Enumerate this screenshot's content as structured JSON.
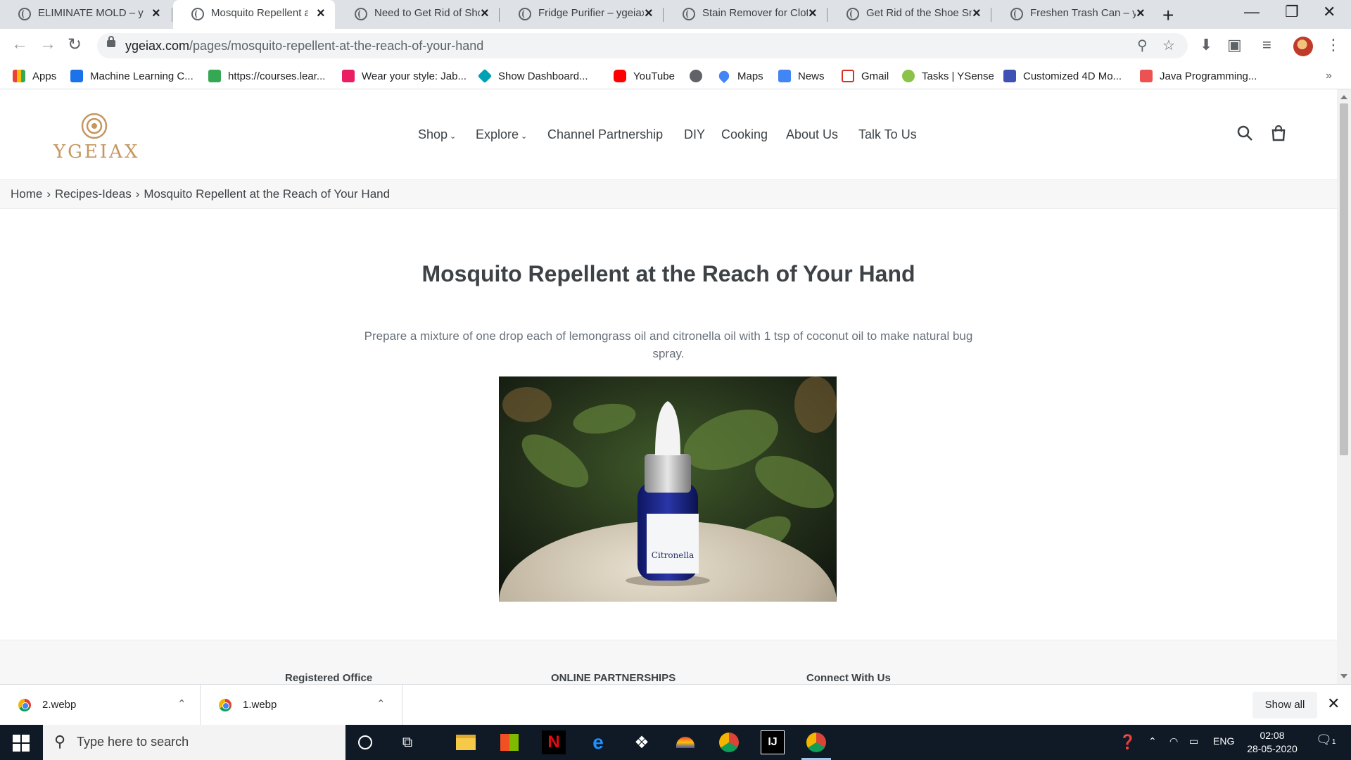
{
  "browser": {
    "tabs": [
      {
        "title": "ELIMINATE MOLD – yg",
        "active": false
      },
      {
        "title": "Mosquito Repellent at t",
        "active": true
      },
      {
        "title": "Need to Get Rid of Sho",
        "active": false
      },
      {
        "title": "Fridge Purifier – ygeiax",
        "active": false
      },
      {
        "title": "Stain Remover for Clot",
        "active": false
      },
      {
        "title": "Get Rid of the Shoe Sm",
        "active": false
      },
      {
        "title": "Freshen Trash Can – yg",
        "active": false
      }
    ],
    "url_host": "ygeiax.com",
    "url_path": "/pages/mosquito-repellent-at-the-reach-of-your-hand",
    "bookmarks": [
      {
        "label": "Apps",
        "icon": "apps-grid-icon",
        "color": "#ea4335"
      },
      {
        "label": "Machine Learning C...",
        "icon": "ml-course-icon",
        "color": "#1a73e8"
      },
      {
        "label": "https://courses.lear...",
        "icon": "courses-icon",
        "color": "#34a853"
      },
      {
        "label": "Wear your style: Jab...",
        "icon": "myntra-icon",
        "color": "#e91e63"
      },
      {
        "label": "Show Dashboard...",
        "icon": "dashboard-icon",
        "color": "#00a1b5"
      },
      {
        "label": "YouTube",
        "icon": "youtube-icon",
        "color": "#ff0000"
      },
      {
        "label": "",
        "icon": "globe-icon",
        "color": "#5f6368"
      },
      {
        "label": "Maps",
        "icon": "maps-icon",
        "color": "#4285f4"
      },
      {
        "label": "News",
        "icon": "news-icon",
        "color": "#4285f4"
      },
      {
        "label": "Gmail",
        "icon": "gmail-icon",
        "color": "#d93025"
      },
      {
        "label": "Tasks | YSense",
        "icon": "ysense-icon",
        "color": "#8bc34a"
      },
      {
        "label": "Customized 4D Mo...",
        "icon": "4d-icon",
        "color": "#3f51b5"
      },
      {
        "label": "Java Programming...",
        "icon": "udemy-icon",
        "color": "#ec5252"
      }
    ]
  },
  "site": {
    "logo_text": "YGEIAX",
    "nav": [
      {
        "label": "Shop",
        "dropdown": true
      },
      {
        "label": "Explore",
        "dropdown": true
      },
      {
        "label": "Channel Partnership",
        "dropdown": false
      },
      {
        "label": "DIY",
        "dropdown": false
      },
      {
        "label": "Cooking",
        "dropdown": false
      },
      {
        "label": "About Us",
        "dropdown": false
      },
      {
        "label": "Talk To Us",
        "dropdown": false
      }
    ],
    "breadcrumb": [
      "Home",
      "Recipes-Ideas",
      "Mosquito Repellent at the Reach of Your Hand"
    ],
    "breadcrumb_sep": "›",
    "page_title": "Mosquito Repellent at the Reach of Your Hand",
    "page_text": "Prepare a mixture of one drop each of lemongrass oil and citronella oil with 1 tsp of coconut oil to make natural bug spray.",
    "bottle_label": "Citronella",
    "footer_headings": [
      "Registered Office",
      "ONLINE PARTNERSHIPS",
      "Connect With Us"
    ]
  },
  "downloads": {
    "items": [
      "2.webp",
      "1.webp"
    ],
    "show_all": "Show all"
  },
  "taskbar": {
    "search_placeholder": "Type here to search",
    "language": "ENG",
    "time": "02:08",
    "date": "28-05-2020",
    "notification_count": "1"
  }
}
